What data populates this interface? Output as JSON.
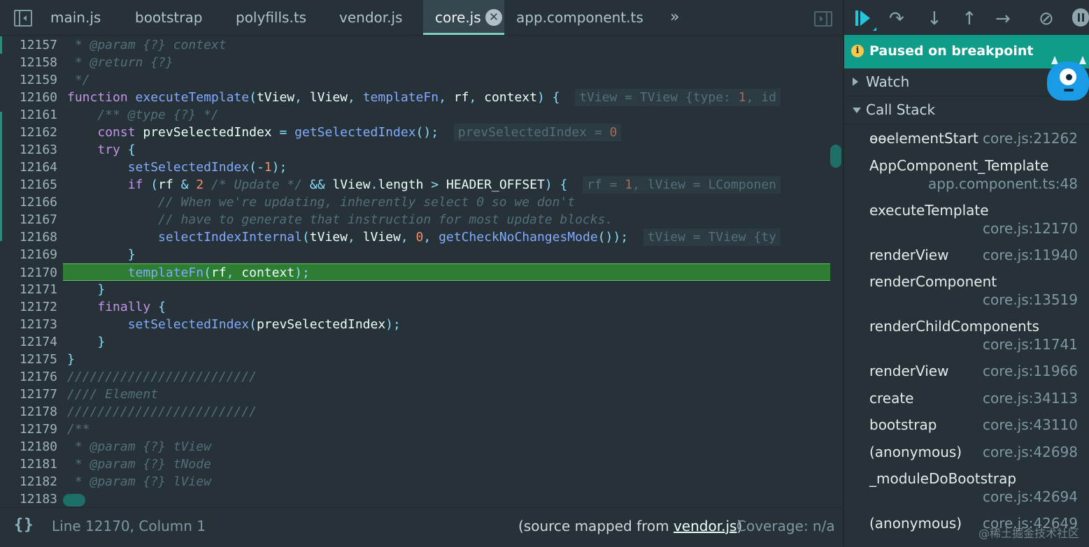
{
  "tabs": [
    {
      "label": "main.js",
      "active": false
    },
    {
      "label": "bootstrap",
      "active": false
    },
    {
      "label": "polyfills.ts",
      "active": false
    },
    {
      "label": "vendor.js",
      "active": false
    },
    {
      "label": "core.js",
      "active": true
    },
    {
      "label": "app.component.ts",
      "active": false
    }
  ],
  "tab_close_glyph": "✕",
  "more_tabs_glyph": "»",
  "code": {
    "execution_line": "12170",
    "lines": [
      {
        "n": "12157",
        "text": " * @param {?} context"
      },
      {
        "n": "12158",
        "text": " * @return {?}"
      },
      {
        "n": "12159",
        "text": " */"
      },
      {
        "n": "12160",
        "text": "function executeTemplate(tView, lView, templateFn, rf, context) {",
        "inline": "tView = TView {type: 1, id"
      },
      {
        "n": "12161",
        "text": "    /** @type {?} */"
      },
      {
        "n": "12162",
        "text": "    const prevSelectedIndex = getSelectedIndex();",
        "inline": "prevSelectedIndex = 0"
      },
      {
        "n": "12163",
        "text": "    try {"
      },
      {
        "n": "12164",
        "text": "        setSelectedIndex(-1);"
      },
      {
        "n": "12165",
        "text": "        if (rf & 2 /* Update */ && lView.length > HEADER_OFFSET) {",
        "inline": "rf = 1, lView = LComponen"
      },
      {
        "n": "12166",
        "text": "            // When we're updating, inherently select 0 so we don't"
      },
      {
        "n": "12167",
        "text": "            // have to generate that instruction for most update blocks."
      },
      {
        "n": "12168",
        "text": "            selectIndexInternal(tView, lView, 0, getCheckNoChangesMode());",
        "inline": "tView = TView {ty"
      },
      {
        "n": "12169",
        "text": "        }"
      },
      {
        "n": "12170",
        "text": "        templateFn(rf, context);"
      },
      {
        "n": "12171",
        "text": "    }"
      },
      {
        "n": "12172",
        "text": "    finally {"
      },
      {
        "n": "12173",
        "text": "        setSelectedIndex(prevSelectedIndex);"
      },
      {
        "n": "12174",
        "text": "    }"
      },
      {
        "n": "12175",
        "text": "}"
      },
      {
        "n": "12176",
        "text": "/////////////////////////"
      },
      {
        "n": "12177",
        "text": "//// Element"
      },
      {
        "n": "12178",
        "text": "/////////////////////////"
      },
      {
        "n": "12179",
        "text": "/**"
      },
      {
        "n": "12180",
        "text": " * @param {?} tView"
      },
      {
        "n": "12181",
        "text": " * @param {?} tNode"
      },
      {
        "n": "12182",
        "text": " * @param {?} lView"
      },
      {
        "n": "12183",
        "text": ""
      }
    ]
  },
  "status": {
    "braces": "{}",
    "cursor": "Line 12170, Column 1",
    "source_prefix": "(source mapped from ",
    "source_file": "vendor.js",
    "source_suffix": ")",
    "coverage": "Coverage: n/a"
  },
  "debugger": {
    "paused_message": "Paused on breakpoint",
    "info_glyph": "i",
    "watch_label": "Watch",
    "call_stack_label": "Call Stack",
    "frames": [
      {
        "name": "ɵɵelementStart",
        "location": "core.js:21262",
        "wrap": false
      },
      {
        "name": "AppComponent_Template",
        "location": "app.component.ts:48",
        "wrap": true
      },
      {
        "name": "executeTemplate",
        "location": "core.js:12170",
        "wrap": true
      },
      {
        "name": "renderView",
        "location": "core.js:11940",
        "wrap": false
      },
      {
        "name": "renderComponent",
        "location": "core.js:13519",
        "wrap": true
      },
      {
        "name": "renderChildComponents",
        "location": "core.js:11741",
        "wrap": true
      },
      {
        "name": "renderView",
        "location": "core.js:11966",
        "wrap": false
      },
      {
        "name": "create",
        "location": "core.js:34113",
        "wrap": false
      },
      {
        "name": "bootstrap",
        "location": "core.js:43110",
        "wrap": false
      },
      {
        "name": "(anonymous)",
        "location": "core.js:42698",
        "wrap": false
      },
      {
        "name": "_moduleDoBootstrap",
        "location": "core.js:42694",
        "wrap": true
      },
      {
        "name": "(anonymous)",
        "location": "core.js:42649",
        "wrap": false
      }
    ]
  },
  "watermark": "@稀土掘金技术社区",
  "colors": {
    "accent": "#80cbc4",
    "paused_banner": "#0f9d8a",
    "execution_line": "#2e7d32"
  }
}
